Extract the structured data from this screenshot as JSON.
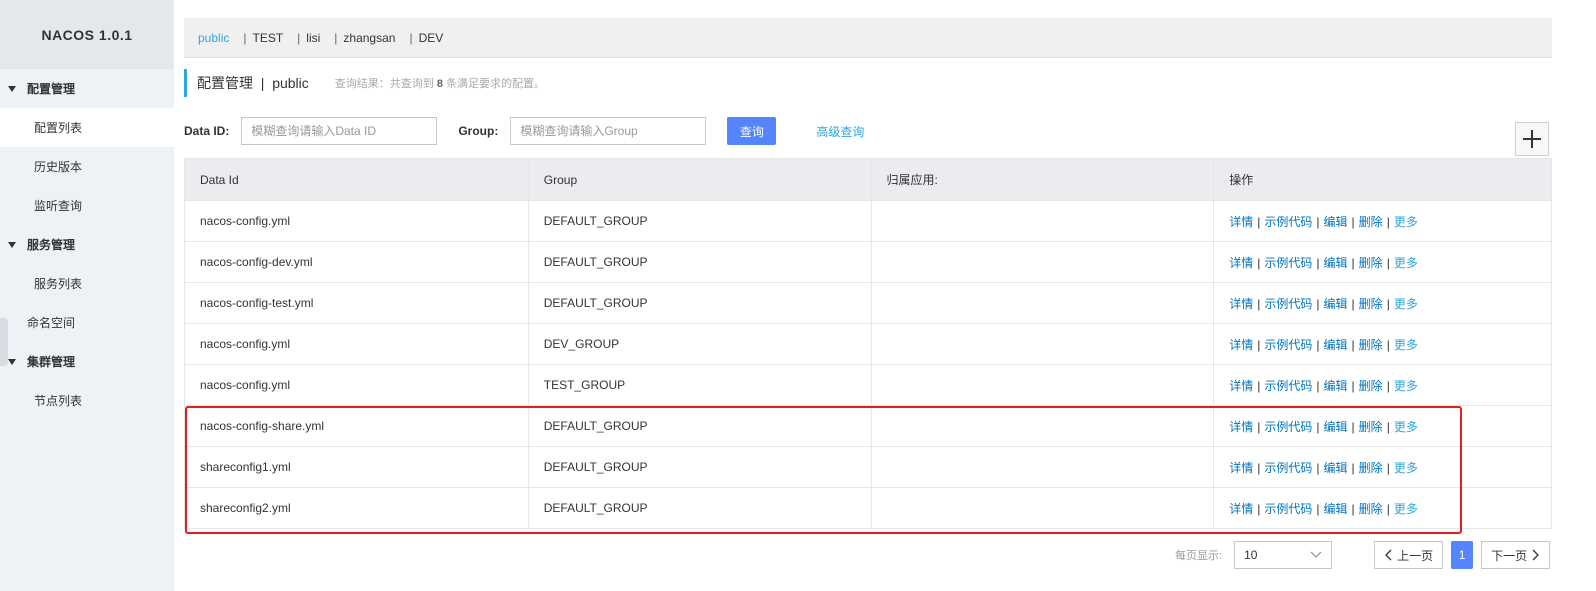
{
  "app": {
    "title": "NACOS 1.0.1"
  },
  "sidebar": {
    "groups": [
      {
        "label": "配置管理",
        "items": [
          {
            "label": "配置列表",
            "active": true
          },
          {
            "label": "历史版本"
          },
          {
            "label": "监听查询"
          }
        ]
      },
      {
        "label": "服务管理",
        "items": [
          {
            "label": "服务列表"
          }
        ]
      },
      {
        "label": "命名空间",
        "plain": true
      },
      {
        "label": "集群管理",
        "items": [
          {
            "label": "节点列表"
          }
        ]
      }
    ]
  },
  "namespaces": [
    {
      "label": "public",
      "active": true
    },
    {
      "label": "TEST"
    },
    {
      "label": "lisi"
    },
    {
      "label": "zhangsan"
    },
    {
      "label": "DEV"
    }
  ],
  "page": {
    "title": "配置管理  |  public",
    "result_prefix": "查询结果：共查询到",
    "result_count": "8",
    "result_suffix": "条满足要求的配置。"
  },
  "search": {
    "data_id_label": "Data ID:",
    "data_id_placeholder": "模糊查询请输入Data ID",
    "group_label": "Group:",
    "group_placeholder": "模糊查询请输入Group",
    "query_button": "查询",
    "advanced_link": "高级查询"
  },
  "table": {
    "columns": [
      "Data Id",
      "Group",
      "归属应用:",
      "操作"
    ],
    "ops": {
      "detail": "详情",
      "sample": "示例代码",
      "edit": "编辑",
      "delete": "删除",
      "more": "更多"
    },
    "rows": [
      {
        "data_id": "nacos-config.yml",
        "group": "DEFAULT_GROUP",
        "app": ""
      },
      {
        "data_id": "nacos-config-dev.yml",
        "group": "DEFAULT_GROUP",
        "app": ""
      },
      {
        "data_id": "nacos-config-test.yml",
        "group": "DEFAULT_GROUP",
        "app": ""
      },
      {
        "data_id": "nacos-config.yml",
        "group": "DEV_GROUP",
        "app": ""
      },
      {
        "data_id": "nacos-config.yml",
        "group": "TEST_GROUP",
        "app": ""
      },
      {
        "data_id": "nacos-config-share.yml",
        "group": "DEFAULT_GROUP",
        "app": ""
      },
      {
        "data_id": "shareconfig1.yml",
        "group": "DEFAULT_GROUP",
        "app": ""
      },
      {
        "data_id": "shareconfig2.yml",
        "group": "DEFAULT_GROUP",
        "app": ""
      }
    ]
  },
  "pagination": {
    "page_size_label": "每页显示:",
    "page_size": "10",
    "prev": "上一页",
    "current": "1",
    "next": "下一页"
  },
  "colors": {
    "primary": "#5584ff",
    "accent": "#2fa6dd",
    "link": "#0073c1",
    "highlight": "#e02020"
  }
}
